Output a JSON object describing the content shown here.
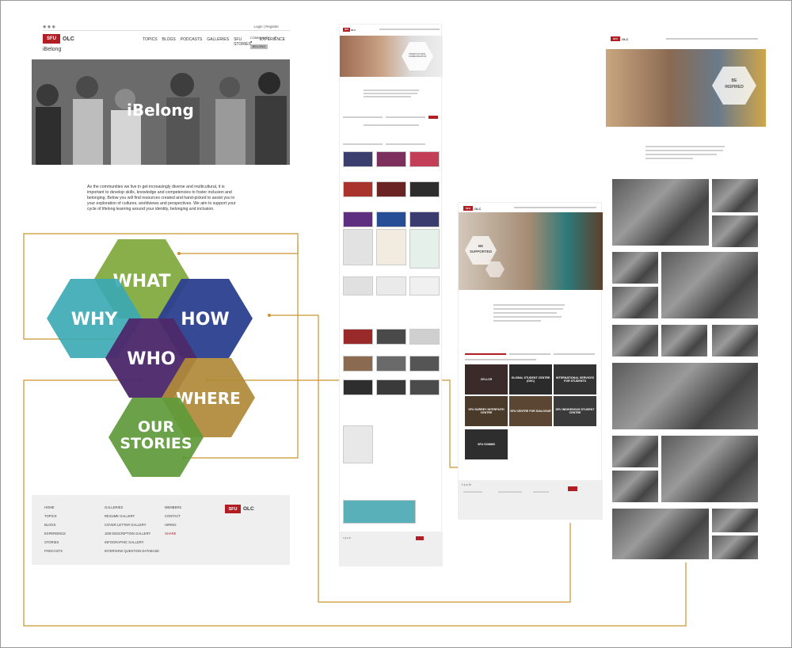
{
  "main_page": {
    "topbar": {
      "login": "Login",
      "separator": "|",
      "register": "Register"
    },
    "logo": {
      "mark": "SFU",
      "text": "OLC"
    },
    "site_title": "iBelong",
    "nav": [
      "TOPICS",
      "BLOGS",
      "PODCASTS",
      "GALLERIES",
      "SFU STORIES",
      "EXPERIENCE"
    ],
    "nav_tabs": [
      "COMMUNITY ●",
      "BELONG"
    ],
    "hero_title": "iBelong",
    "intro": "As the communities we live in get increasingly diverse and multicultural, it is important to develop skills, knowledge and competencies to foster inclusion and belonging. Below you will find resources created and hand-picked to assist you in your exploration of cultures, worldviews and perspectives. We aim to support your cycle of lifelong learning around your identity, belonging and inclusion.",
    "hexagons": {
      "what": "WHAT",
      "why": "WHY",
      "how": "HOW",
      "who": "WHO",
      "where": "WHERE",
      "stories_1": "OUR",
      "stories_2": "STORIES"
    },
    "footer": {
      "col1": [
        "HOME",
        "TOPICS",
        "BLOGS",
        "EXPERIENCE",
        "STORIES",
        "PODCASTS"
      ],
      "col2": [
        "GALLERIES",
        "RESUME GALLERY",
        "COVER LETTER GALLERY",
        "JOB DESCRIPTION GALLERY",
        "INFOGRAPHIC GALLERY",
        "INTERVIEW QUESTION DATABASE"
      ],
      "col3": [
        "MEMBERS",
        "CONTACT",
        "HIRING",
        "SHARE"
      ]
    }
  },
  "how_page": {
    "logo": {
      "mark": "SFU",
      "text": "OLC"
    },
    "hero_label": "INTERCULTURAL COMMUNICATION"
  },
  "who_page": {
    "logo": {
      "mark": "SFU",
      "text": "OLC"
    },
    "hero_label_1": "BE",
    "hero_label_2": "INSPIRED"
  },
  "where_page": {
    "logo": {
      "mark": "SFU",
      "text": "OLC"
    },
    "hero_label_1": "BE",
    "hero_label_2": "SUPPORTED",
    "tiles": [
      "CELLCR",
      "GLOBAL STUDENT CENTRE (GSC)",
      "INTERNATIONAL SERVICES FOR STUDENTS",
      "SFU SURREY INTERFAITH CENTRE",
      "SFU CENTRE FOR DIALOGUE",
      "SFU INDIGENOUS STUDENT CENTRE",
      "SFU SOMMS"
    ]
  },
  "colors": {
    "sfu_red": "#b11f24",
    "hex_what": "#7ea83a",
    "hex_why": "#3aa8b5",
    "hex_how": "#2b3f8f",
    "hex_who": "#4d2a6b",
    "hex_where": "#b08a3a",
    "hex_stories": "#5e9a3a",
    "connector": "#c9942e"
  }
}
